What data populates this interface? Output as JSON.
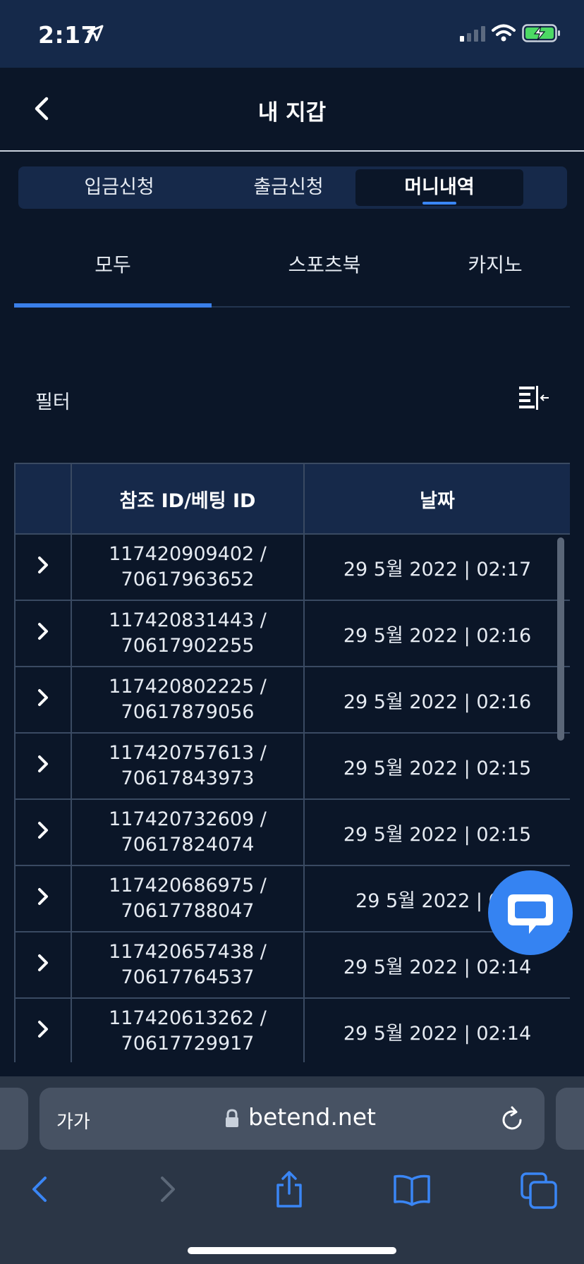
{
  "status_bar": {
    "time": "2:17"
  },
  "header": {
    "title": "내 지갑"
  },
  "segments": [
    {
      "label": "입금신청"
    },
    {
      "label": "출금신청"
    },
    {
      "label": "머니내역"
    }
  ],
  "active_segment": "머니내역",
  "tabs": [
    {
      "label": "모두"
    },
    {
      "label": "스포츠북"
    },
    {
      "label": "카지노"
    }
  ],
  "active_tab": "모두",
  "filter": {
    "label": "필터"
  },
  "table": {
    "columns": [
      "",
      "참조 ID/베팅 ID",
      "날짜"
    ],
    "rows": [
      {
        "id": "117420909402 /\n70617963652",
        "date": "29 5월 2022 | 02:17"
      },
      {
        "id": "117420831443 /\n70617902255",
        "date": "29 5월 2022 | 02:16"
      },
      {
        "id": "117420802225 /\n70617879056",
        "date": "29 5월 2022 | 02:16"
      },
      {
        "id": "117420757613 /\n70617843973",
        "date": "29 5월 2022 | 02:15"
      },
      {
        "id": "117420732609 /\n70617824074",
        "date": "29 5월 2022 | 02:15"
      },
      {
        "id": "117420686975 /\n70617788047",
        "date": "29 5월 2022 | 02:"
      },
      {
        "id": "117420657438 /\n70617764537",
        "date": "29 5월 2022 | 02:14"
      },
      {
        "id": "117420613262 /\n70617729917",
        "date": "29 5월 2022 | 02:14"
      }
    ]
  },
  "browser": {
    "text_size_label": "가가",
    "url": "betend.net"
  },
  "colors": {
    "accent": "#3a7fe9",
    "background": "#0b1628",
    "header_bg": "#16294a",
    "chat": "#3583f2"
  },
  "icons": [
    "location-arrow-icon",
    "signal-icon",
    "wifi-icon",
    "battery-charging-icon",
    "back-chevron-icon",
    "filter-collapse-icon",
    "chevron-right-icon",
    "chat-icon",
    "lock-icon",
    "reload-icon",
    "share-icon",
    "bookmarks-icon",
    "tabs-icon"
  ]
}
